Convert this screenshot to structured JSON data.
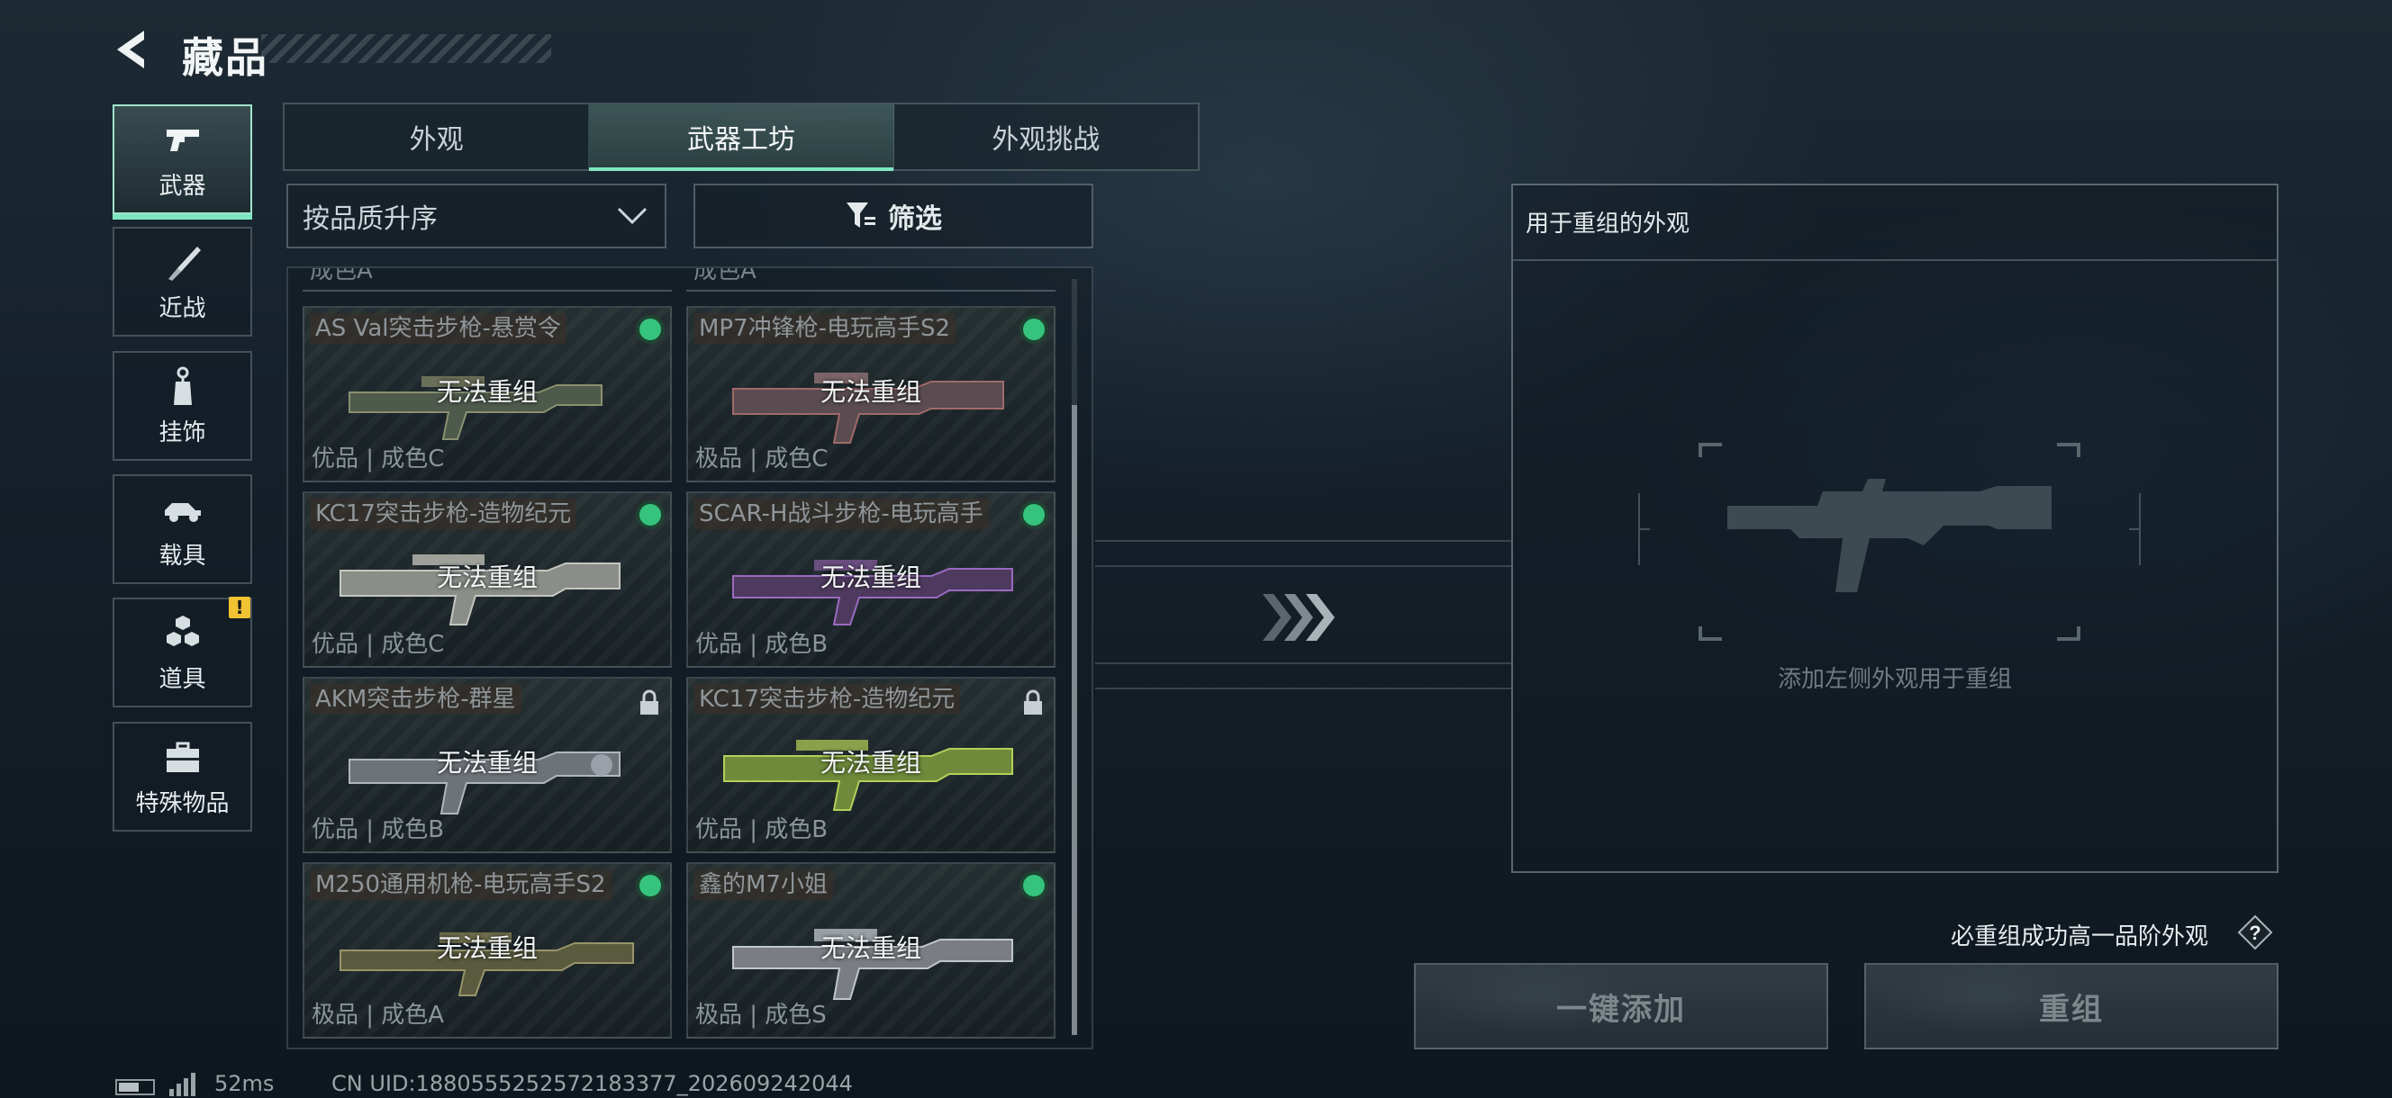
{
  "header": {
    "title": "藏品"
  },
  "categories": [
    {
      "label": "武器",
      "icon": "pistol-icon",
      "active": true
    },
    {
      "label": "近战",
      "icon": "knife-icon"
    },
    {
      "label": "挂饰",
      "icon": "charm-icon"
    },
    {
      "label": "载具",
      "icon": "vehicle-icon"
    },
    {
      "label": "道具",
      "icon": "cubes-icon",
      "badge": "!"
    },
    {
      "label": "特殊物品",
      "icon": "briefcase-icon"
    }
  ],
  "tabs": [
    {
      "label": "外观"
    },
    {
      "label": "武器工坊",
      "active": true
    },
    {
      "label": "外观挑战"
    }
  ],
  "sort": {
    "label": "按品质升序"
  },
  "filter": {
    "label": "筛选"
  },
  "partial_row": {
    "left_text": "成色A",
    "right_text": "成色A"
  },
  "cards": [
    {
      "name": "AS Val突击步枪-悬赏令",
      "status": "green-dot",
      "overlay": "无法重组",
      "meta": "优品 | 成色C"
    },
    {
      "name": "MP7冲锋枪-电玩高手S2",
      "status": "green-dot",
      "overlay": "无法重组",
      "meta": "极品 | 成色C"
    },
    {
      "name": "KC17突击步枪-造物纪元",
      "status": "green-dot",
      "overlay": "无法重组",
      "meta": "优品 | 成色C"
    },
    {
      "name": "SCAR-H战斗步枪-电玩高手",
      "status": "green-dot",
      "overlay": "无法重组",
      "meta": "优品 | 成色B"
    },
    {
      "name": "AKM突击步枪-群星",
      "status": "lock-icon",
      "overlay": "无法重组",
      "meta": "优品 | 成色B"
    },
    {
      "name": "KC17突击步枪-造物纪元",
      "status": "lock-icon",
      "overlay": "无法重组",
      "meta": "优品 | 成色B"
    },
    {
      "name": "M250通用机枪-电玩高手S2",
      "status": "green-dot",
      "overlay": "无法重组",
      "meta": "极品 | 成色A"
    },
    {
      "name": "鑫的M7小姐",
      "status": "green-dot",
      "overlay": "无法重组",
      "meta": "极品 | 成色S"
    }
  ],
  "recombine": {
    "title": "用于重组的外观",
    "hint": "添加左侧外观用于重组",
    "guarantee": "必重组成功高一品阶外观",
    "add_button": "一键添加",
    "recombine_button": "重组"
  },
  "statusbar": {
    "ping": "52ms",
    "uid": "CN UID:1880555252572183377_202609242044"
  },
  "colors": {
    "accent": "#7ee7c1",
    "status_green": "#36c37d",
    "badge_yellow": "#f1c232"
  }
}
